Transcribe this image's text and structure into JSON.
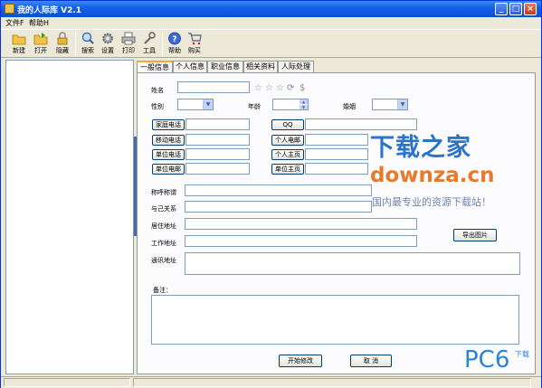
{
  "window": {
    "title": "我的人际库 V2.1"
  },
  "title_buttons": {
    "minimize": "_",
    "maximize": "□",
    "close": "×"
  },
  "menu": [
    {
      "label": "文件F"
    },
    {
      "label": "帮助H"
    }
  ],
  "toolbar": [
    {
      "label": "新建",
      "icon": "new-folder-icon"
    },
    {
      "label": "打开",
      "icon": "open-folder-icon"
    },
    {
      "label": "隐藏",
      "icon": "lock-icon"
    },
    {
      "label": "搜索",
      "icon": "search-icon"
    },
    {
      "label": "设置",
      "icon": "gear-icon"
    },
    {
      "label": "打印",
      "icon": "printer-icon"
    },
    {
      "label": "工具",
      "icon": "tools-icon"
    },
    {
      "label": "帮助",
      "icon": "help-icon"
    },
    {
      "label": "购买",
      "icon": "cart-icon"
    }
  ],
  "tabs": [
    {
      "label": "一般信息",
      "active": true
    },
    {
      "label": "个人信息",
      "active": false
    },
    {
      "label": "职业信息",
      "active": false
    },
    {
      "label": "相关资料",
      "active": false
    },
    {
      "label": "人际处理",
      "active": false
    }
  ],
  "form": {
    "name_label": "姓名",
    "name_value": "",
    "gender_label": "性别",
    "gender_value": "",
    "age_label": "年龄",
    "age_value": "",
    "marriage_label": "婚姻",
    "marriage_value": "",
    "home_phone_button": "家庭电话",
    "mobile_phone_button": "移动电话",
    "work_phone_button": "单位电话",
    "work_email_button": "单位电邮",
    "qq_button": "QQ",
    "personal_email_button": "个人电邮",
    "personal_homepage_button": "个人主页",
    "work_homepage_button": "单位主页",
    "nickname_label": "称呼称谓",
    "relation_label": "与己关系",
    "residence_label": "居住地址",
    "work_address_label": "工作地址",
    "mail_address_label": "通讯地址",
    "notes_label": "备注：",
    "export_photo_button": "导出图片",
    "start_edit_button": "开始修改",
    "cancel_button": "取 消"
  },
  "watermarks": {
    "site_cn": "下载之家",
    "site_url": "downza.cn",
    "slogan": "国内最专业的资源下载站！",
    "pc6": "PC6",
    "pc6_sub": "下载"
  },
  "colors": {
    "titlebar": "#1660e8",
    "tab_active_accent": "#f2a83b",
    "watermark_blue": "#2b74c7",
    "watermark_orange": "#e87a2a"
  }
}
